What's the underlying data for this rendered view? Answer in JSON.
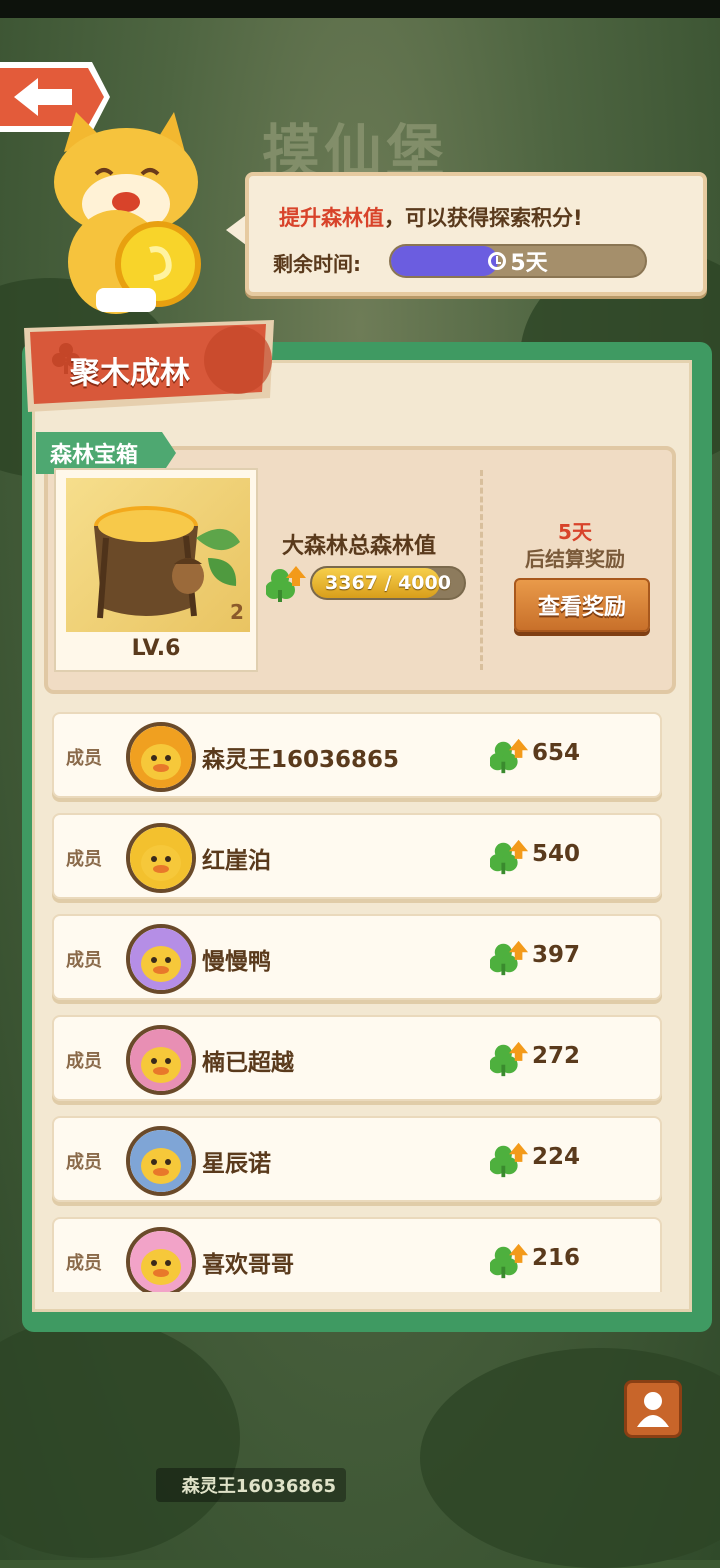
{
  "header": {
    "bg_title": "摸仙堡"
  },
  "tip": {
    "prefix": "提升森林值",
    "suffix": "，可以获得探索积分!",
    "time_label": "剩余时间:",
    "time_value": "5天",
    "time_progress": 0.42
  },
  "panel": {
    "ribbon_title": "聚木成林",
    "chest_tag": "森林宝箱",
    "chest_count": "2",
    "chest_level": "LV.6",
    "forest_title": "大森林总森林值",
    "forest_value": "3367 / 4000",
    "forest_progress": 0.8418,
    "settle_days": "5天",
    "settle_text": "后结算奖励",
    "view_button": "查看奖励"
  },
  "members": [
    {
      "role": "成员",
      "name": "森灵王16036865",
      "score": "654",
      "avatar_color": "#f0a020"
    },
    {
      "role": "成员",
      "name": "红崖泊",
      "score": "540",
      "avatar_color": "#f3c12e"
    },
    {
      "role": "成员",
      "name": "慢慢鸭",
      "score": "397",
      "avatar_color": "#b58ee6"
    },
    {
      "role": "成员",
      "name": "楠已超越",
      "score": "272",
      "avatar_color": "#e88fb4"
    },
    {
      "role": "成员",
      "name": "星辰诺",
      "score": "224",
      "avatar_color": "#7fa5d6"
    },
    {
      "role": "成员",
      "name": "喜欢哥哥",
      "score": "216",
      "avatar_color": "#f2a3c8"
    }
  ],
  "bottom": {
    "player_name": "森灵王16036865"
  },
  "colors": {
    "panel_green": "#3f9a62",
    "ribbon_red": "#d8583a",
    "accent_orange": "#c8702a",
    "progress_purple": "#6b5de0"
  }
}
